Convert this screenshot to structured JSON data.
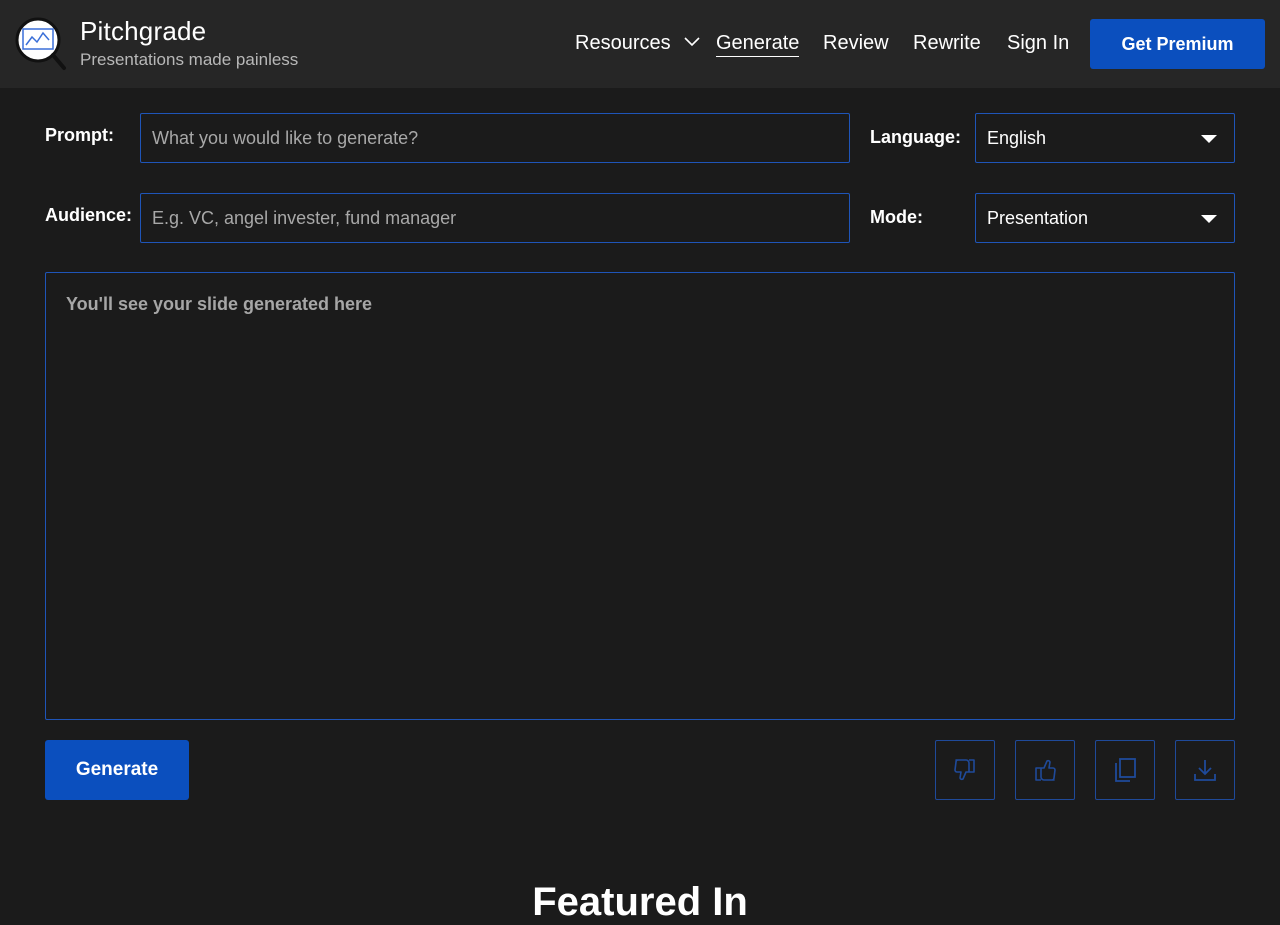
{
  "header": {
    "brand_name": "Pitchgrade",
    "brand_tagline": "Presentations made painless",
    "nav": {
      "resources": "Resources",
      "generate": "Generate",
      "review": "Review",
      "rewrite": "Rewrite",
      "sign_in": "Sign In"
    },
    "premium_label": "Get Premium"
  },
  "form": {
    "prompt_label": "Prompt:",
    "prompt_placeholder": "What you would like to generate?",
    "audience_label": "Audience:",
    "audience_placeholder": "E.g. VC, angel invester, fund manager",
    "language_label": "Language:",
    "language_value": "English",
    "mode_label": "Mode:",
    "mode_value": "Presentation"
  },
  "output": {
    "placeholder": "You'll see your slide generated here"
  },
  "actions": {
    "generate_label": "Generate",
    "icons": [
      "thumbs-down-icon",
      "thumbs-up-icon",
      "copy-icon",
      "download-icon"
    ]
  },
  "footer": {
    "heading": "Featured In"
  },
  "colors": {
    "accent": "#0b4fbe",
    "border": "#1f55b8",
    "background": "#1b1b1b",
    "header_bg": "#262626"
  }
}
